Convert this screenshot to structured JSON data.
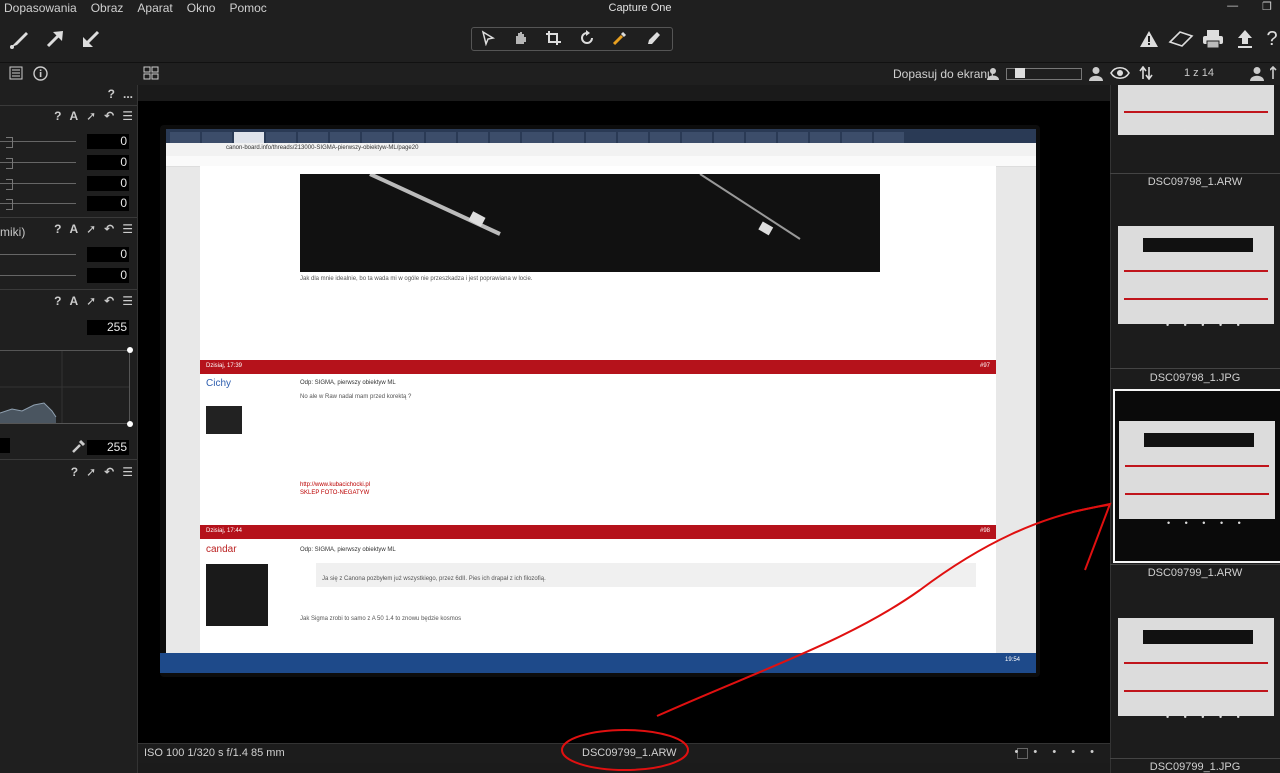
{
  "app_title": "Capture One",
  "menu": [
    "Dopasowania",
    "Obraz",
    "Aparat",
    "Okno",
    "Pomoc"
  ],
  "toolbar": {
    "left_tools": [
      "brush-icon",
      "arrow-up-right-icon",
      "arrow-down-left-icon"
    ],
    "cursor_tools": [
      "pointer-icon",
      "hand-icon",
      "crop-icon",
      "rotate-icon",
      "picker-icon",
      "eraser-icon"
    ],
    "right_tools": [
      "warning-icon",
      "eraser-tag-icon",
      "print-icon",
      "export-icon",
      "help-icon"
    ]
  },
  "subbar": {
    "fit_label": "Dopasuj do ekranu",
    "page_count": "1 z 14"
  },
  "left_panel": {
    "help": "?",
    "more": "...",
    "values_group1": [
      "0",
      "0",
      "0",
      "0"
    ],
    "cut_label": "miki)",
    "values_group2": [
      "0",
      "0"
    ],
    "level_top": "255",
    "level_bottom": "255",
    "letter_a": "A"
  },
  "viewer": {
    "exif": "ISO 100 1/320 s f/1.4 85 mm",
    "filename": "DSC09799_1.ARW",
    "dots": "• • • • •"
  },
  "screen_content": {
    "url": "canon-board.info/threads/213000-SIGMA-pierwszy-obiektyw-ML/page20",
    "post1_time": "Dzisiaj, 17:39",
    "post1_num": "#97",
    "user1": "Cichy",
    "post1_title": "Odp: SIGMA, pierwszy obiektyw ML",
    "post1_text": "No ale w Raw nadal mam przed korektą ?",
    "post2_time": "Dzisiaj, 17:44",
    "post2_num": "#98",
    "user2": "candar",
    "post2_title": "Odp: SIGMA, pierwszy obiektyw ML",
    "line_ideal": "Jak dla mnie idealnie, bo ta wada mi w ogóle nie przeszkadza i jest poprawiana w locie.",
    "line_quote": "Ja się z Canona pozbyłem już wszystkiego, przez 6dII. Pies ich drapał z ich filozofią.",
    "line_sigma": "Jak Sigma zrobi to samo z A 50 1.4 to znowu będzie kosmos",
    "link_text": "http://www.kubacichocki.pl",
    "shop_text": "SKLEP FOTO-NEGATYW",
    "clock": "19:54"
  },
  "filmstrip": [
    {
      "label": "DSC09798_1.ARW",
      "selected": false
    },
    {
      "label": "DSC09798_1.JPG",
      "selected": false
    },
    {
      "label": "DSC09799_1.ARW",
      "selected": true
    },
    {
      "label": "DSC09799_1.JPG",
      "selected": false
    }
  ],
  "thumb_dots": "• • • • •",
  "colors": {
    "background": "#1b1b1b",
    "forum_red": "#b5121b",
    "annotation_red": "#e01010"
  }
}
